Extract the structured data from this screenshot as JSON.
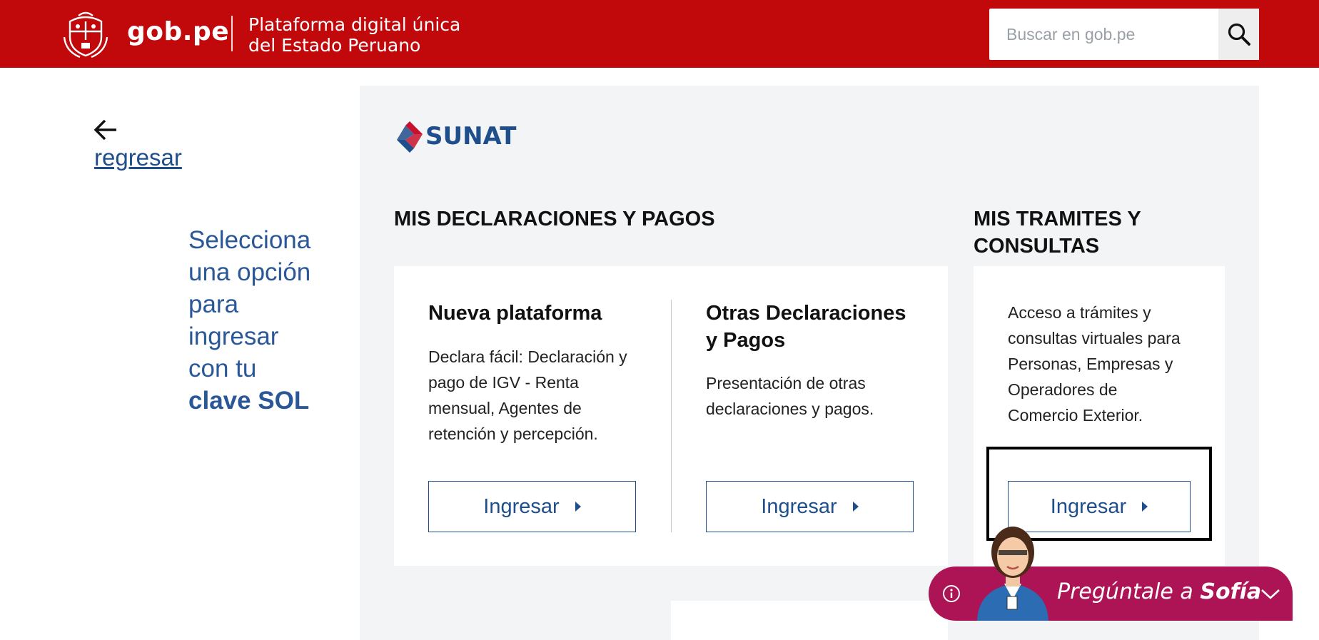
{
  "header": {
    "logo_text": "gob.pe",
    "tagline_line1": "Plataforma digital única",
    "tagline_line2": "del Estado Peruano",
    "search_placeholder": "Buscar en gob.pe"
  },
  "back": {
    "label": "regresar"
  },
  "intro": {
    "lines": [
      "Selecciona",
      "una opción",
      "para",
      "ingresar",
      "con tu"
    ],
    "emphasis": "clave SOL"
  },
  "brand": {
    "name": "SUNAT"
  },
  "sections": {
    "declaraciones_title": "MIS DECLARACIONES Y PAGOS",
    "tramites_title_line1": "MIS TRAMITES Y",
    "tramites_title_line2": "CONSULTAS"
  },
  "cards": [
    {
      "title": "Nueva plataforma",
      "desc_lines": [
        "Declara fácil: Declaración y",
        "pago de IGV - Renta",
        "mensual, Agentes de",
        "retención y percepción."
      ],
      "button": "Ingresar"
    },
    {
      "title_line1": "Otras Declaraciones",
      "title_line2": "y Pagos",
      "desc_lines": [
        "Presentación de otras",
        "declaraciones y pagos."
      ],
      "button": "Ingresar"
    },
    {
      "desc_lines": [
        "Acceso a trámites y",
        "consultas virtuales para",
        "Personas, Empresas y",
        "Operadores de",
        "Comercio Exterior."
      ],
      "button": "Ingresar"
    }
  ],
  "sofia": {
    "prefix": "Pregúntale a ",
    "name": "Sofía"
  },
  "colors": {
    "header_red": "#c1080b",
    "link_blue": "#1f4e8c",
    "intro_blue": "#2a5797",
    "sofia_magenta": "#ad1456",
    "panel_gray": "#f3f4f5"
  },
  "icons": [
    "peru-crest-icon",
    "search-icon",
    "arrow-left-icon",
    "sunat-logo-icon",
    "caret-right-icon",
    "info-icon",
    "sofia-avatar-icon",
    "chevron-down-icon"
  ]
}
